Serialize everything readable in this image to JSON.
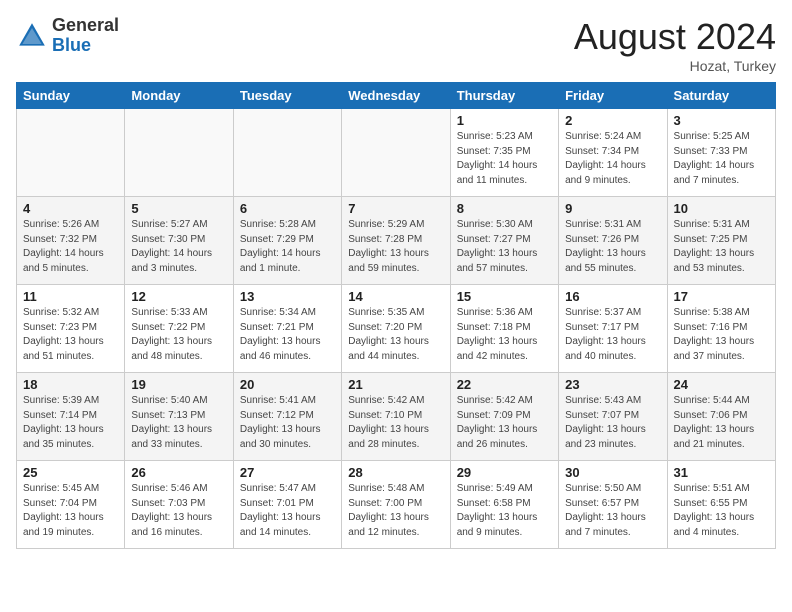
{
  "header": {
    "logo_general": "General",
    "logo_blue": "Blue",
    "month_year": "August 2024",
    "location": "Hozat, Turkey"
  },
  "weekdays": [
    "Sunday",
    "Monday",
    "Tuesday",
    "Wednesday",
    "Thursday",
    "Friday",
    "Saturday"
  ],
  "weeks": [
    [
      {
        "num": "",
        "info": ""
      },
      {
        "num": "",
        "info": ""
      },
      {
        "num": "",
        "info": ""
      },
      {
        "num": "",
        "info": ""
      },
      {
        "num": "1",
        "info": "Sunrise: 5:23 AM\nSunset: 7:35 PM\nDaylight: 14 hours\nand 11 minutes."
      },
      {
        "num": "2",
        "info": "Sunrise: 5:24 AM\nSunset: 7:34 PM\nDaylight: 14 hours\nand 9 minutes."
      },
      {
        "num": "3",
        "info": "Sunrise: 5:25 AM\nSunset: 7:33 PM\nDaylight: 14 hours\nand 7 minutes."
      }
    ],
    [
      {
        "num": "4",
        "info": "Sunrise: 5:26 AM\nSunset: 7:32 PM\nDaylight: 14 hours\nand 5 minutes."
      },
      {
        "num": "5",
        "info": "Sunrise: 5:27 AM\nSunset: 7:30 PM\nDaylight: 14 hours\nand 3 minutes."
      },
      {
        "num": "6",
        "info": "Sunrise: 5:28 AM\nSunset: 7:29 PM\nDaylight: 14 hours\nand 1 minute."
      },
      {
        "num": "7",
        "info": "Sunrise: 5:29 AM\nSunset: 7:28 PM\nDaylight: 13 hours\nand 59 minutes."
      },
      {
        "num": "8",
        "info": "Sunrise: 5:30 AM\nSunset: 7:27 PM\nDaylight: 13 hours\nand 57 minutes."
      },
      {
        "num": "9",
        "info": "Sunrise: 5:31 AM\nSunset: 7:26 PM\nDaylight: 13 hours\nand 55 minutes."
      },
      {
        "num": "10",
        "info": "Sunrise: 5:31 AM\nSunset: 7:25 PM\nDaylight: 13 hours\nand 53 minutes."
      }
    ],
    [
      {
        "num": "11",
        "info": "Sunrise: 5:32 AM\nSunset: 7:23 PM\nDaylight: 13 hours\nand 51 minutes."
      },
      {
        "num": "12",
        "info": "Sunrise: 5:33 AM\nSunset: 7:22 PM\nDaylight: 13 hours\nand 48 minutes."
      },
      {
        "num": "13",
        "info": "Sunrise: 5:34 AM\nSunset: 7:21 PM\nDaylight: 13 hours\nand 46 minutes."
      },
      {
        "num": "14",
        "info": "Sunrise: 5:35 AM\nSunset: 7:20 PM\nDaylight: 13 hours\nand 44 minutes."
      },
      {
        "num": "15",
        "info": "Sunrise: 5:36 AM\nSunset: 7:18 PM\nDaylight: 13 hours\nand 42 minutes."
      },
      {
        "num": "16",
        "info": "Sunrise: 5:37 AM\nSunset: 7:17 PM\nDaylight: 13 hours\nand 40 minutes."
      },
      {
        "num": "17",
        "info": "Sunrise: 5:38 AM\nSunset: 7:16 PM\nDaylight: 13 hours\nand 37 minutes."
      }
    ],
    [
      {
        "num": "18",
        "info": "Sunrise: 5:39 AM\nSunset: 7:14 PM\nDaylight: 13 hours\nand 35 minutes."
      },
      {
        "num": "19",
        "info": "Sunrise: 5:40 AM\nSunset: 7:13 PM\nDaylight: 13 hours\nand 33 minutes."
      },
      {
        "num": "20",
        "info": "Sunrise: 5:41 AM\nSunset: 7:12 PM\nDaylight: 13 hours\nand 30 minutes."
      },
      {
        "num": "21",
        "info": "Sunrise: 5:42 AM\nSunset: 7:10 PM\nDaylight: 13 hours\nand 28 minutes."
      },
      {
        "num": "22",
        "info": "Sunrise: 5:42 AM\nSunset: 7:09 PM\nDaylight: 13 hours\nand 26 minutes."
      },
      {
        "num": "23",
        "info": "Sunrise: 5:43 AM\nSunset: 7:07 PM\nDaylight: 13 hours\nand 23 minutes."
      },
      {
        "num": "24",
        "info": "Sunrise: 5:44 AM\nSunset: 7:06 PM\nDaylight: 13 hours\nand 21 minutes."
      }
    ],
    [
      {
        "num": "25",
        "info": "Sunrise: 5:45 AM\nSunset: 7:04 PM\nDaylight: 13 hours\nand 19 minutes."
      },
      {
        "num": "26",
        "info": "Sunrise: 5:46 AM\nSunset: 7:03 PM\nDaylight: 13 hours\nand 16 minutes."
      },
      {
        "num": "27",
        "info": "Sunrise: 5:47 AM\nSunset: 7:01 PM\nDaylight: 13 hours\nand 14 minutes."
      },
      {
        "num": "28",
        "info": "Sunrise: 5:48 AM\nSunset: 7:00 PM\nDaylight: 13 hours\nand 12 minutes."
      },
      {
        "num": "29",
        "info": "Sunrise: 5:49 AM\nSunset: 6:58 PM\nDaylight: 13 hours\nand 9 minutes."
      },
      {
        "num": "30",
        "info": "Sunrise: 5:50 AM\nSunset: 6:57 PM\nDaylight: 13 hours\nand 7 minutes."
      },
      {
        "num": "31",
        "info": "Sunrise: 5:51 AM\nSunset: 6:55 PM\nDaylight: 13 hours\nand 4 minutes."
      }
    ]
  ]
}
